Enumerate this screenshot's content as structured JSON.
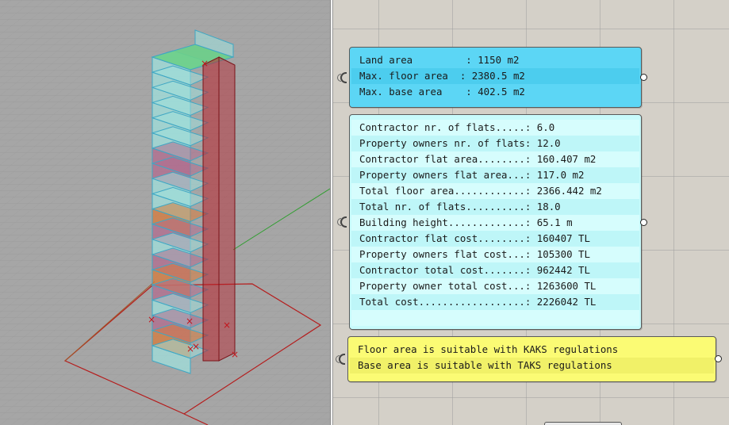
{
  "viewport": {
    "view_name": "perspective-viewport",
    "colors": {
      "background": "#a6a6a6",
      "grid_line": "#999999",
      "axis_x": "#b22222",
      "axis_y": "#2e9e2e",
      "building_glass": "#9fe0dc",
      "building_edge": "#3fa7c4",
      "floor_pink": "#b16b8e",
      "floor_orange": "#d77a3a",
      "core_red": "#b8202a",
      "roof_green": "#6bd08a",
      "marker": "#c4151c"
    }
  },
  "area_panel": {
    "lines": [
      "Land area         : 1150 m2",
      "Max. floor area  : 2380.5 m2",
      "Max. base area    : 402.5 m2"
    ]
  },
  "stats_panel": {
    "lines": [
      "Contractor nr. of flats.....: 6.0",
      "Property owners nr. of flats: 12.0",
      "Contractor flat area........: 160.407 m2",
      "Property owners flat area...: 117.0 m2",
      "Total floor area............: 2366.442 m2",
      "Total nr. of flats..........: 18.0",
      "Building height.............: 65.1 m",
      "Contractor flat cost........: 160407 TL",
      "Property owners flat cost...: 105300 TL",
      "Contractor total cost.......: 962442 TL",
      "Property owner total cost...: 1263600 TL",
      "Total cost..................: 2226042 TL"
    ]
  },
  "regulations_panel": {
    "lines": [
      "Floor area is suitable with KAKS regulations",
      "Base area is suitable with TAKS regulations"
    ]
  }
}
